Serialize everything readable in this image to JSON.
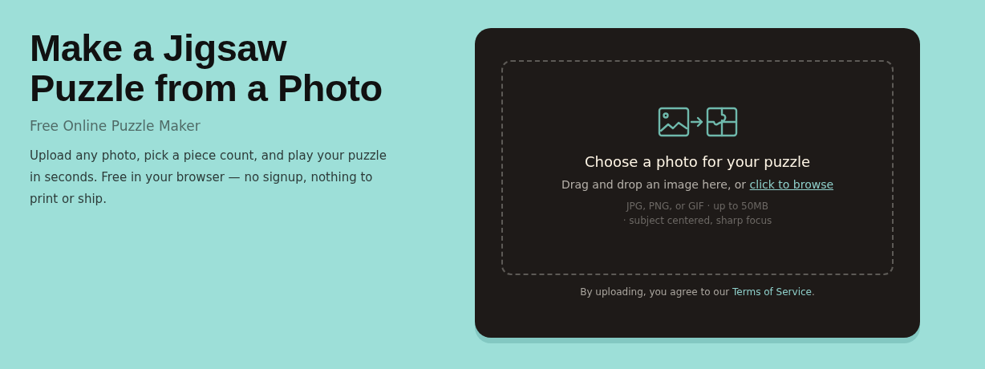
{
  "hero": {
    "title": "Make a Jigsaw Puzzle from a Photo",
    "subtitle": "Free Online Puzzle Maker",
    "description": "Upload any photo, pick a piece count, and play your puzzle in seconds. Free in your browser — no signup, nothing to print or ship."
  },
  "upload": {
    "heading": "Choose a photo for your puzzle",
    "prompt": "Drag and drop an image here, or ",
    "browse_link": "click to browse",
    "hints": [
      "JPG, PNG, or GIF · up to 50MB",
      "· subject centered, sharp focus"
    ],
    "consent": {
      "before": "By uploading, you agree to our ",
      "link": "Terms of Service",
      "after": "."
    }
  }
}
